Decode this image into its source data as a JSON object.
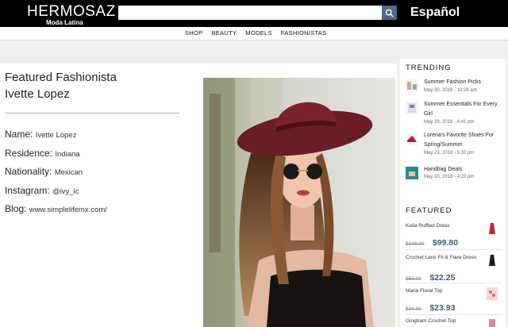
{
  "header": {
    "logo_main": "HERMOSAZ",
    "logo_sub": "Moda Latina",
    "search_placeholder": "",
    "language": "Español"
  },
  "nav": [
    "SHOP",
    "BEAUTY",
    "MODELS",
    "FASHIONISTAS"
  ],
  "article": {
    "heading_line1": "Featured Fashionista",
    "heading_line2": "Ivette Lopez",
    "facts": [
      {
        "label": "Name:",
        "value": "Ivette Lopez"
      },
      {
        "label": "Residence:",
        "value": "Indiana"
      },
      {
        "label": "Nationality:",
        "value": "Mexican"
      },
      {
        "label": "Instagram:",
        "value": "@ivy_lc"
      },
      {
        "label": "Blog:",
        "value": "www.simplelifemx.com/"
      }
    ]
  },
  "sidebar": {
    "trending_title": "TRENDING",
    "trending": [
      {
        "title": "Summer Fashion Picks",
        "date": "May 30, 2018 - 10:28 am"
      },
      {
        "title": "Summer Essentials For Every Girl",
        "date": "May 29, 2018 - 4:41 pm"
      },
      {
        "title": "Lorena's Favorite Shoes For Spring/Summer",
        "date": "May 23, 2018 - 5:33 pm"
      },
      {
        "title": "Handbag Deals",
        "date": "May 20, 2018 - 4:23 pm"
      }
    ],
    "featured_title": "FEATURED",
    "featured": [
      {
        "name": "Keila Ruffled Dress",
        "old_price": "$248.00",
        "new_price": "$99.80"
      },
      {
        "name": "Crochet Lace Fit & Flare Dress",
        "old_price": "$59.00",
        "new_price": "$22.25"
      },
      {
        "name": "Maria Floral Top",
        "old_price": "$34.90",
        "new_price": "$23.93"
      },
      {
        "name": "Gingham Crochet Top",
        "old_price": "",
        "new_price": ""
      }
    ]
  }
}
